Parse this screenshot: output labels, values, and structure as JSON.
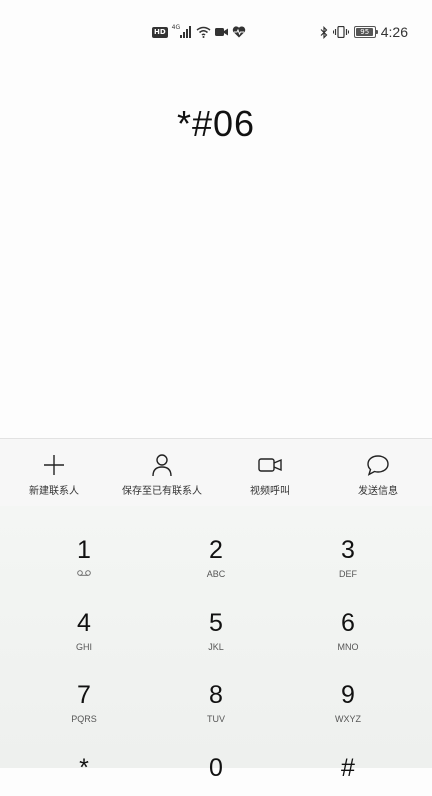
{
  "status_bar": {
    "left_icons": [
      "hd-icon",
      "4g-signal-icon",
      "wifi-icon",
      "video-camera-icon",
      "heart-rate-icon"
    ],
    "hd_label": "HD",
    "network_label": "4G",
    "right_icons": [
      "bluetooth-icon",
      "vibrate-icon",
      "battery-icon"
    ],
    "battery_level": "95",
    "time": "4:26"
  },
  "dialer": {
    "number": "*#06"
  },
  "actions": [
    {
      "label": "新建联系人",
      "icon": "plus-icon"
    },
    {
      "label": "保存至已有联系人",
      "icon": "person-icon"
    },
    {
      "label": "视频呼叫",
      "icon": "video-call-icon"
    },
    {
      "label": "发送信息",
      "icon": "message-bubble-icon"
    }
  ],
  "keypad": {
    "keys": [
      {
        "digit": "1",
        "letters": ""
      },
      {
        "digit": "2",
        "letters": "ABC"
      },
      {
        "digit": "3",
        "letters": "DEF"
      },
      {
        "digit": "4",
        "letters": "GHI"
      },
      {
        "digit": "5",
        "letters": "JKL"
      },
      {
        "digit": "6",
        "letters": "MNO"
      },
      {
        "digit": "7",
        "letters": "PQRS"
      },
      {
        "digit": "8",
        "letters": "TUV"
      },
      {
        "digit": "9",
        "letters": "WXYZ"
      },
      {
        "digit": "*",
        "letters": ""
      },
      {
        "digit": "0",
        "letters": ""
      },
      {
        "digit": "#",
        "letters": ""
      }
    ]
  }
}
